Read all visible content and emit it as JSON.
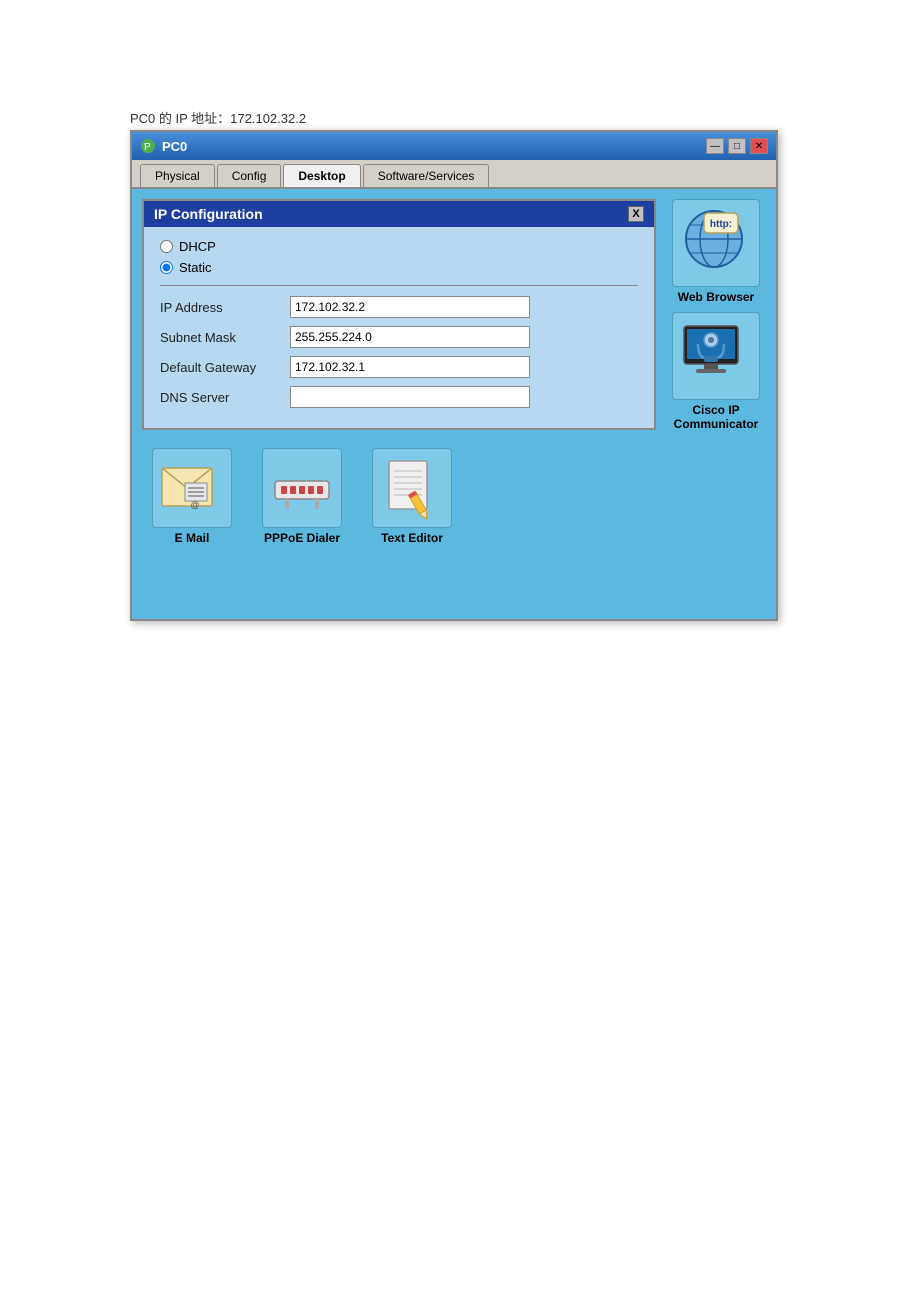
{
  "page": {
    "ip_label": "PC0 的 IP 地址：172.102.32.2"
  },
  "window": {
    "title": "PC0",
    "icon": "computer-icon",
    "tabs": [
      {
        "label": "Physical",
        "active": false
      },
      {
        "label": "Config",
        "active": false
      },
      {
        "label": "Desktop",
        "active": true
      },
      {
        "label": "Software/Services",
        "active": false
      }
    ],
    "controls": {
      "minimize": "—",
      "maximize": "□",
      "close": "✕"
    }
  },
  "ip_config": {
    "title": "IP Configuration",
    "close_label": "X",
    "dhcp_label": "DHCP",
    "static_label": "Static",
    "fields": [
      {
        "label": "IP Address",
        "value": "172.102.32.2"
      },
      {
        "label": "Subnet Mask",
        "value": "255.255.224.0"
      },
      {
        "label": "Default Gateway",
        "value": "172.102.32.1"
      },
      {
        "label": "DNS Server",
        "value": ""
      }
    ]
  },
  "apps": {
    "bottom": [
      {
        "name": "E Mail",
        "icon": "email-icon"
      },
      {
        "name": "PPPoE Dialer",
        "icon": "pppoe-icon"
      },
      {
        "name": "Text Editor",
        "icon": "texteditor-icon"
      }
    ],
    "side": [
      {
        "name": "Web Browser",
        "icon": "webbrowser-icon"
      },
      {
        "name": "Cisco IP Communicator",
        "icon": "cisco-icon"
      }
    ]
  }
}
